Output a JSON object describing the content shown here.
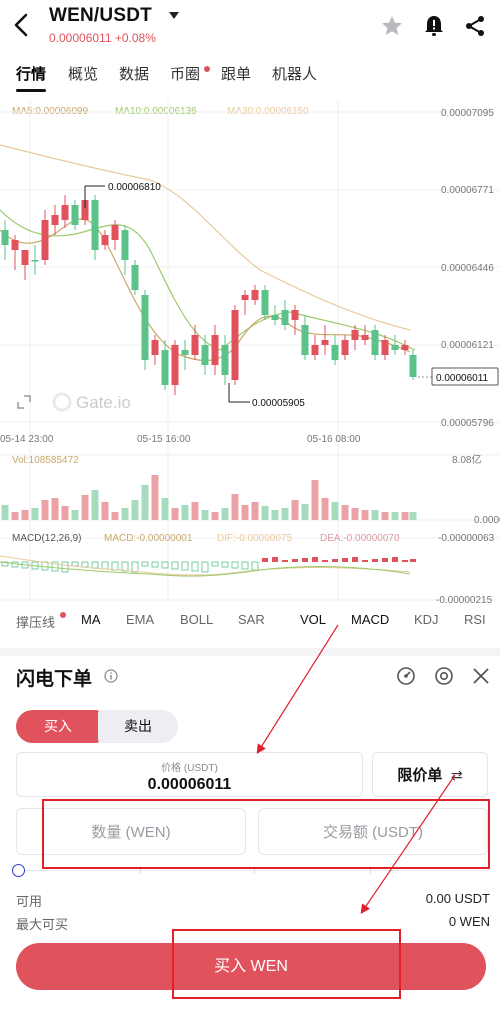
{
  "header": {
    "pair": "WEN/USDT",
    "price_line": "0.00006011 +0.08%"
  },
  "tabs": [
    {
      "label": "行情",
      "active": true
    },
    {
      "label": "概览"
    },
    {
      "label": "数据"
    },
    {
      "label": "币圈",
      "dot": true
    },
    {
      "label": "跟单"
    },
    {
      "label": "机器人"
    }
  ],
  "chart": {
    "ma_legend": [
      "MA5:0.00006099",
      "MA10:0.00006136",
      "MA30:0.00006150"
    ],
    "y_ticks": [
      "0.00007095",
      "0.00006771",
      "0.00006446",
      "0.00006121",
      "0.00005796"
    ],
    "x_ticks": [
      "05-14 23:00",
      "05-15 16:00",
      "05-16 08:00"
    ],
    "high_label": "0.00006810",
    "low_label": "0.00005905",
    "last_price": "0.00006011",
    "watermark": "Gate.io",
    "vol_label": "Vol:108585472",
    "vol_max": "8.08亿",
    "vol_zero": "0.0000",
    "macd_legend": [
      "MACD(12,26,9)",
      "MACD:-0.00000001",
      "DIF:-0.00000075",
      "DEA:-0.00000070"
    ],
    "macd_top": "-0.00000063",
    "macd_bottom": "-0.00000215"
  },
  "indicators": [
    {
      "label": "撑压线",
      "dot": true
    },
    {
      "label": "MA",
      "on": true
    },
    {
      "label": "EMA"
    },
    {
      "label": "BOLL"
    },
    {
      "label": "SAR"
    },
    {
      "label": "VOL",
      "on": true
    },
    {
      "label": "MACD",
      "on": true
    },
    {
      "label": "KDJ"
    },
    {
      "label": "RSI"
    }
  ],
  "order": {
    "title": "闪电下单",
    "buy_tab": "买入",
    "sell_tab": "卖出",
    "price_label": "价格 (USDT)",
    "price_value": "0.00006011",
    "order_type": "限价单",
    "qty_placeholder": "数量 (WEN)",
    "amount_placeholder": "交易额 (USDT)",
    "available_label": "可用",
    "available_value": "0.00 USDT",
    "max_buy_label": "最大可买",
    "max_buy_value": "0 WEN",
    "submit": "买入 WEN"
  },
  "colors": {
    "up": "#e0535d",
    "down": "#5bc28a",
    "ma5": "#c9a86a",
    "ma10": "#9cc96c",
    "ma30": "#e8c99a",
    "annotation": "#e0202a"
  }
}
